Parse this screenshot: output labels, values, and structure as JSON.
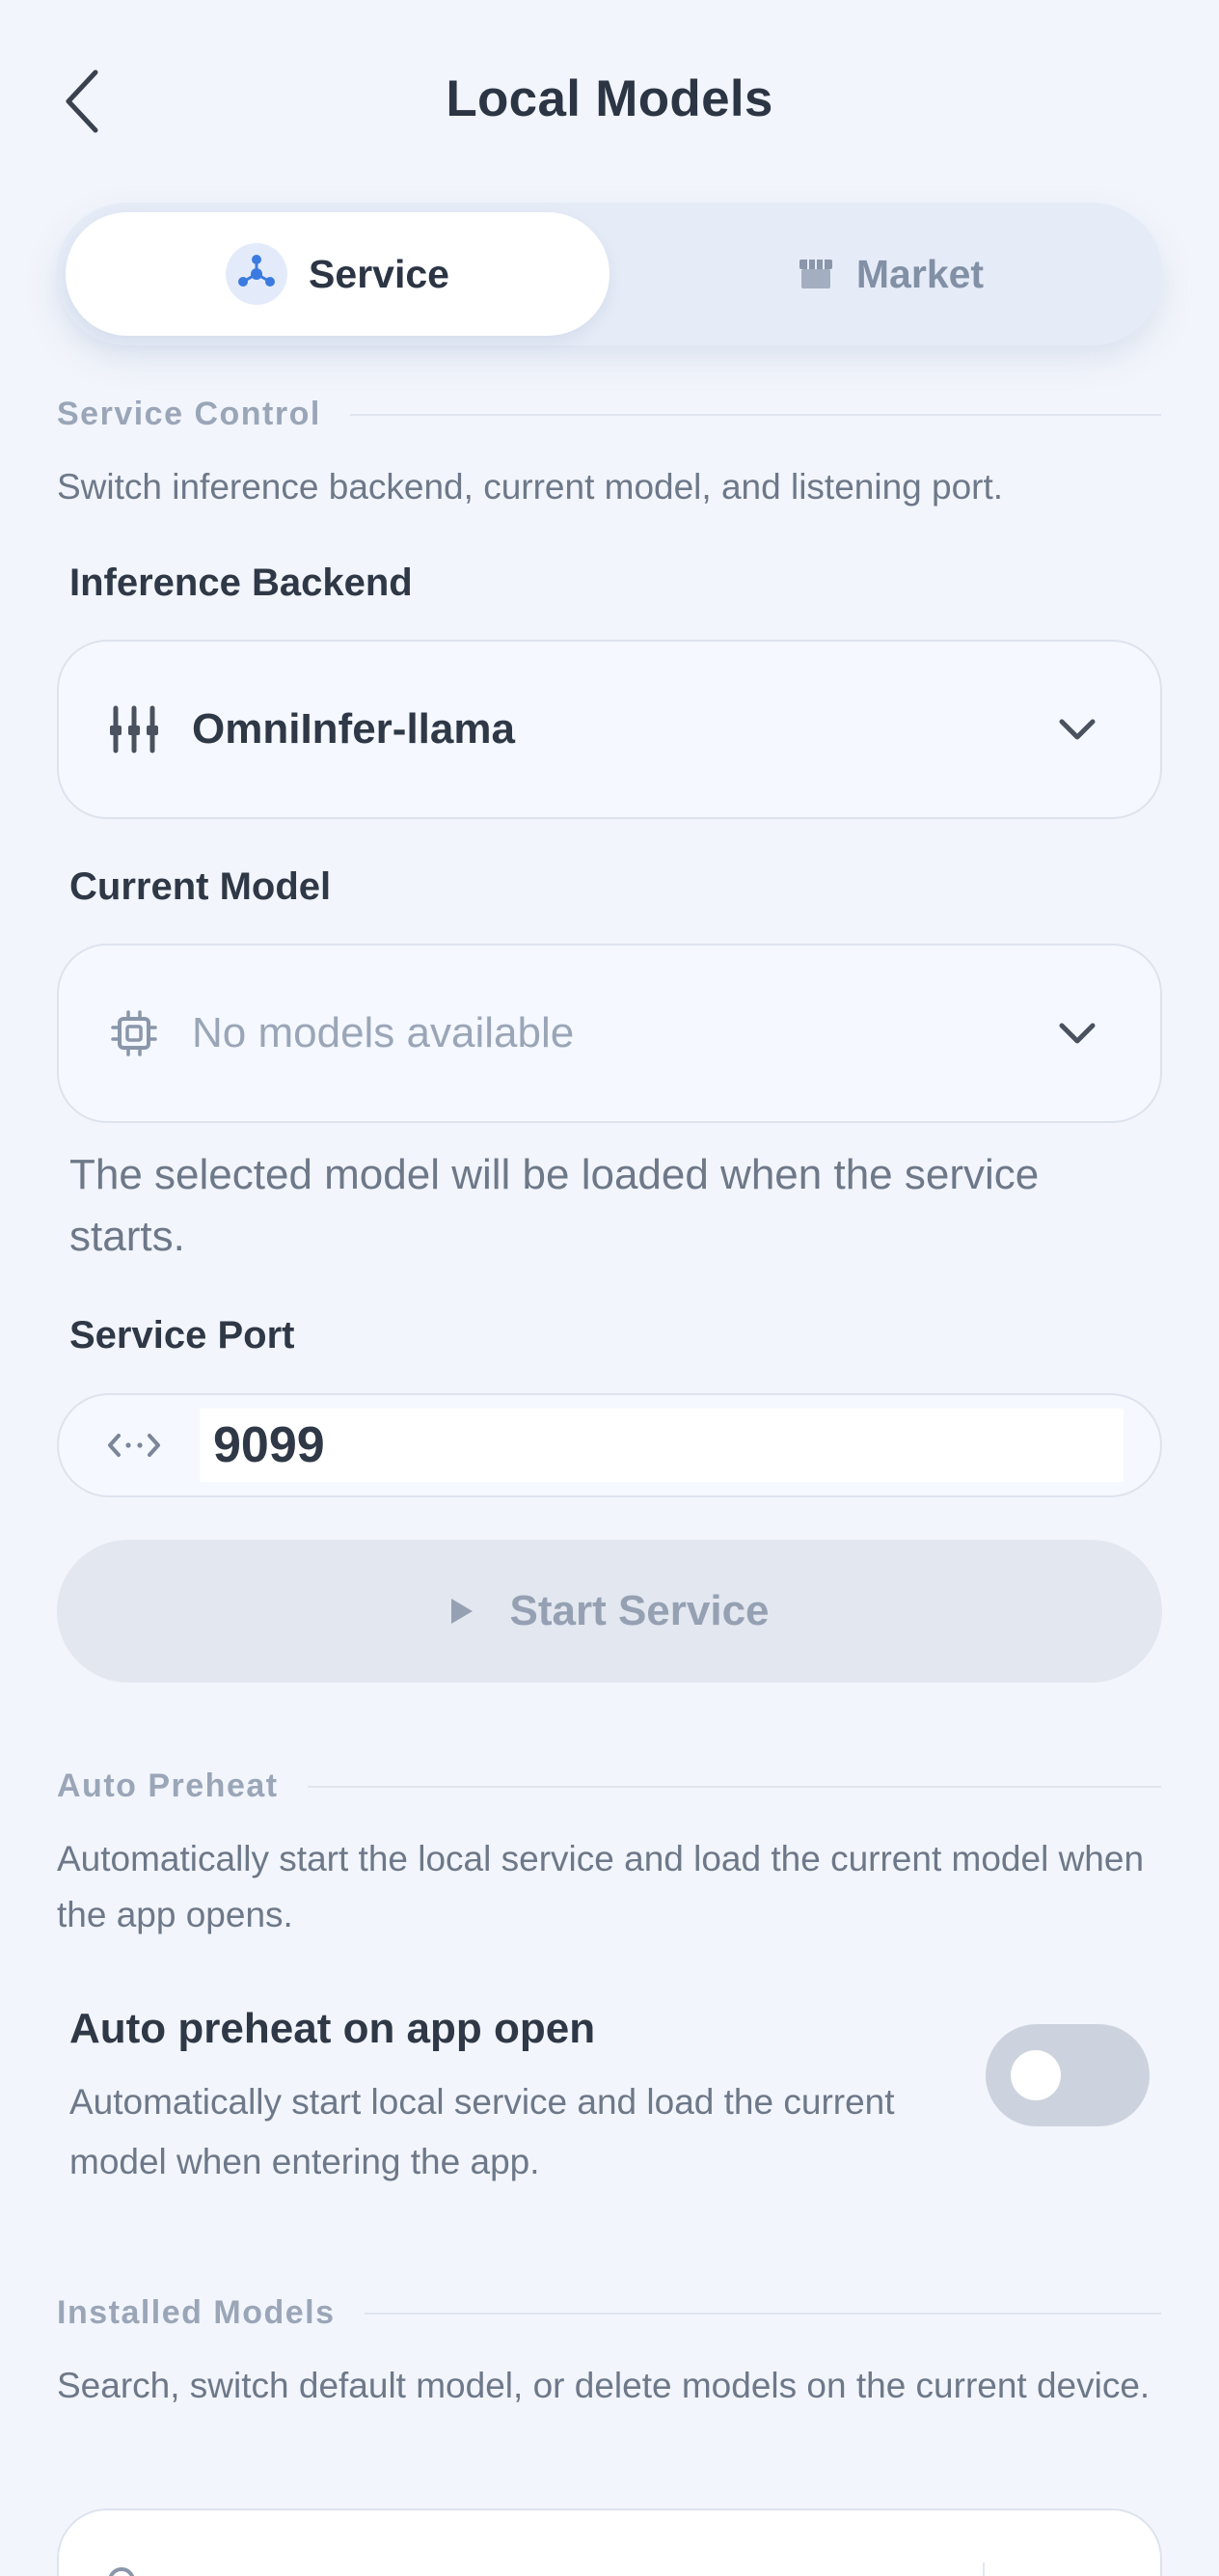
{
  "header": {
    "title": "Local Models"
  },
  "tabs": [
    {
      "label": "Service",
      "active": true
    },
    {
      "label": "Market",
      "active": false
    }
  ],
  "service_control": {
    "section_title": "Service Control",
    "description": "Switch inference backend, current model, and listening port.",
    "backend_label": "Inference Backend",
    "backend_value": "OmniInfer-llama",
    "model_label": "Current Model",
    "model_placeholder": "No models available",
    "model_helper": "The selected model will be loaded when the service starts.",
    "port_label": "Service Port",
    "port_value": "9099",
    "start_button_label": "Start Service"
  },
  "auto_preheat": {
    "section_title": "Auto Preheat",
    "description": "Automatically start the local service and load the current model when the app opens.",
    "toggle_title": "Auto preheat on app open",
    "toggle_description": "Automatically start local service and load the current model when entering the app.",
    "enabled": false
  },
  "installed_models": {
    "section_title": "Installed Models",
    "description": "Search, switch default model, or delete models on the current device."
  },
  "colors": {
    "background": "#f2f5fb",
    "accent_blue": "#3b7be0",
    "muted_text": "#6d7889",
    "disabled_button": "#e3e7ef",
    "toggle_off": "#cdd3de"
  }
}
